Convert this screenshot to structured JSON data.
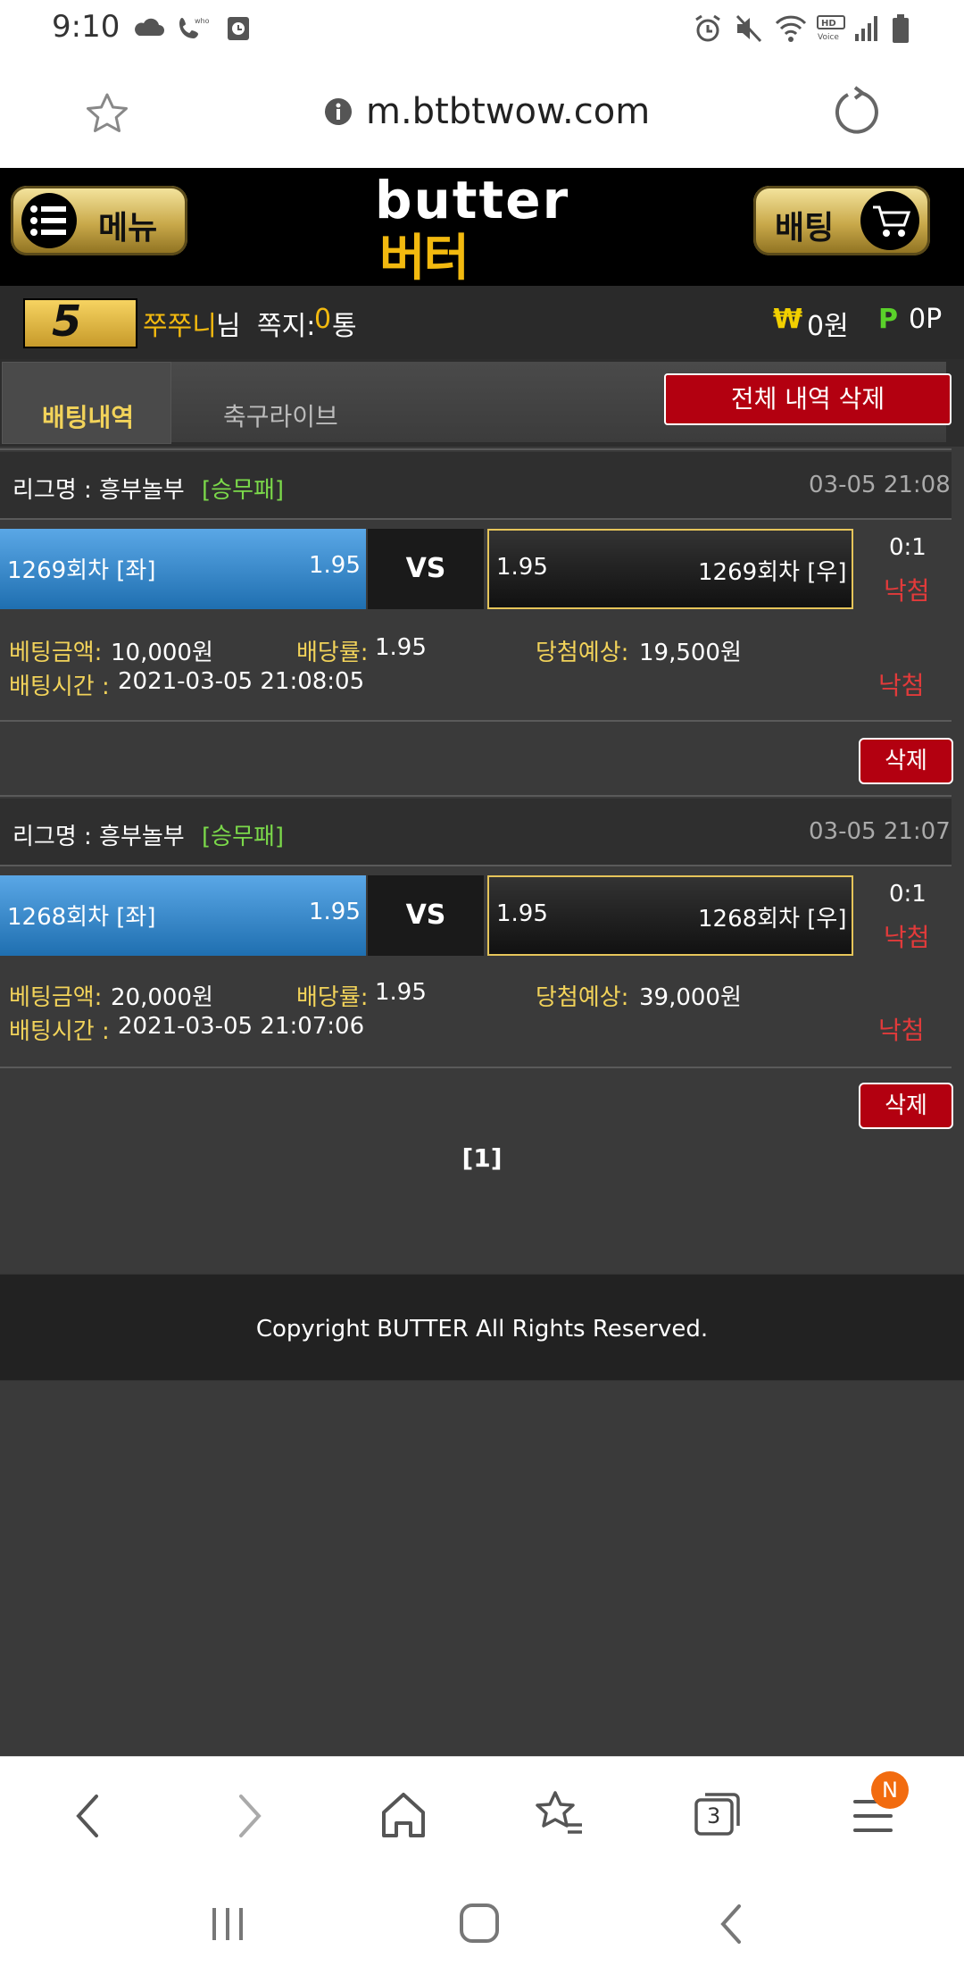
{
  "status_bar": {
    "time": "9:10"
  },
  "browser": {
    "url": "m.btbtwow.com",
    "tabs_count": "3",
    "menu_badge": "N"
  },
  "header": {
    "menu_label": "메뉴",
    "logo_top": "butter",
    "logo_bottom": "버터",
    "bet_label": "배팅"
  },
  "user": {
    "level": "5",
    "name": "쭈쭈니",
    "suffix": "님",
    "messages_label": "쪽지:",
    "messages_count": "0",
    "messages_unit": "통",
    "money_icon": "₩",
    "money": "0원",
    "points_icon": "P",
    "points": "0P"
  },
  "tabs": {
    "betting_history": "배팅내역",
    "soccer_live": "축구라이브",
    "delete_all": "전체 내역 삭제"
  },
  "bets": [
    {
      "league_label": "리그명 : 흥부놀부",
      "league_tag": "[승무패]",
      "datetime": "03-05 21:08",
      "left_team": "1269회차 [좌]",
      "left_odds": "1.95",
      "vs": "VS",
      "right_odds": "1.95",
      "right_team": "1269회차 [우]",
      "score": "0:1",
      "result": "낙첨",
      "amount_label": "베팅금액:",
      "amount": "10,000원",
      "rate_label": "배당률:",
      "rate": "1.95",
      "expected_label": "당첨예상:",
      "expected": "19,500원",
      "time_label": "배팅시간 :",
      "time": "2021-03-05 21:08:05",
      "status": "낙첨",
      "delete": "삭제"
    },
    {
      "league_label": "리그명 : 흥부놀부",
      "league_tag": "[승무패]",
      "datetime": "03-05 21:07",
      "left_team": "1268회차 [좌]",
      "left_odds": "1.95",
      "vs": "VS",
      "right_odds": "1.95",
      "right_team": "1268회차 [우]",
      "score": "0:1",
      "result": "낙첨",
      "amount_label": "베팅금액:",
      "amount": "20,000원",
      "rate_label": "배당률:",
      "rate": "1.95",
      "expected_label": "당첨예상:",
      "expected": "39,000원",
      "time_label": "배팅시간 :",
      "time": "2021-03-05 21:07:06",
      "status": "낙첨",
      "delete": "삭제"
    }
  ],
  "pagination": {
    "current": "[1]"
  },
  "footer": {
    "copyright": "Copyright BUTTER All Rights Reserved."
  },
  "colors": {
    "accent_gold": "#f2b90f",
    "delete_red": "#b30010",
    "league_green": "#7bd94a",
    "lose_red": "#e23a3a"
  }
}
